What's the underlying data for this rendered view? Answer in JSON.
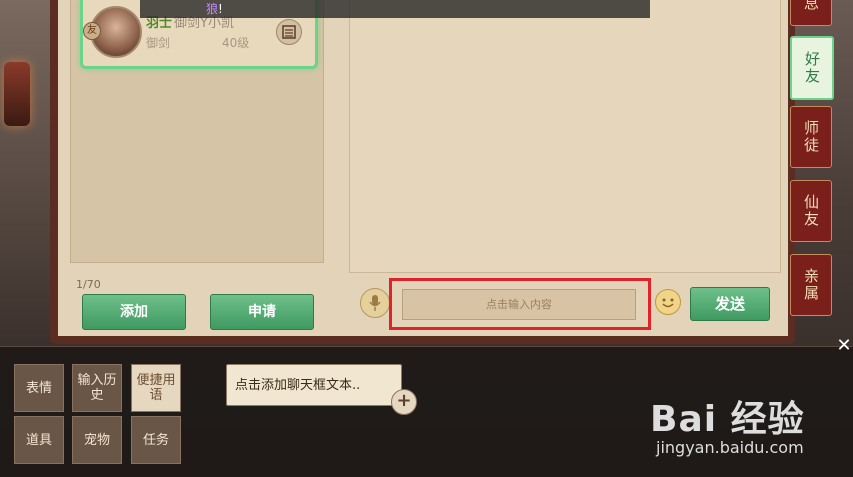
{
  "system_message": {
    "highlight": "狼",
    "suffix": "!"
  },
  "friend": {
    "badge": "友",
    "tag": "羽士",
    "name": "御剑Y小凯",
    "class": "御剑",
    "level": "40级"
  },
  "friend_count": "1/70",
  "buttons": {
    "add": "添加",
    "apply": "申请",
    "send": "发送"
  },
  "chat_input": {
    "placeholder": "点击输入内容"
  },
  "tabs": [
    "息",
    "好友",
    "师徒",
    "仙友",
    "亲属"
  ],
  "active_tab": "好友",
  "quick_panel": {
    "buttons": [
      {
        "label": "表情"
      },
      {
        "label": "输入历史"
      },
      {
        "label": "便捷用语"
      },
      {
        "label": "道具"
      },
      {
        "label": "宠物"
      },
      {
        "label": "任务"
      }
    ],
    "add_text": "点击添加聊天框文本..",
    "close": "✕"
  },
  "watermark": {
    "main": "Bai 经验",
    "sub": "jingyan.baidu.com"
  }
}
